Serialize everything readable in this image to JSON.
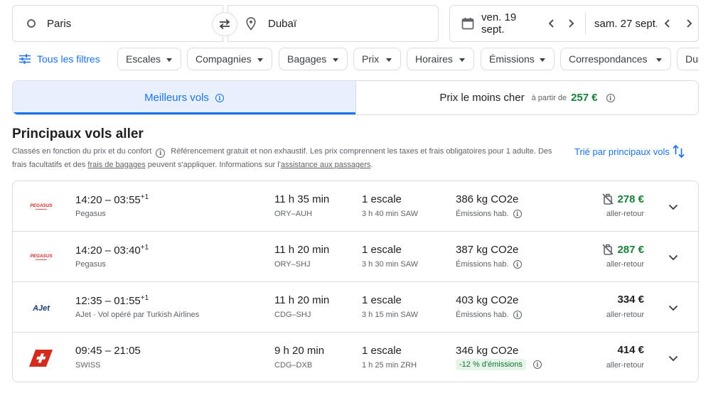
{
  "search": {
    "origin": "Paris",
    "destination": "Dubaï",
    "depart_date": "ven. 19 sept.",
    "return_date": "sam. 27 sept."
  },
  "filters": {
    "all_label": "Tous les filtres",
    "chips": [
      "Escales",
      "Compagnies",
      "Bagages",
      "Prix",
      "Horaires",
      "Émissions",
      "Correspondances",
      "Durée"
    ]
  },
  "tabs": {
    "best": "Meilleurs vols",
    "cheapest": "Prix le moins cher",
    "from_label": "à partir de",
    "from_price": "257 €"
  },
  "section": {
    "title": "Principaux vols aller",
    "desc_1": "Classés en fonction du prix et du confort",
    "desc_2": "Référencement gratuit et non exhaustif. Les prix comprennent les taxes et frais obligatoires pour 1 adulte. Des frais facultatifs et des",
    "desc_link_1": "frais de bagages",
    "desc_3": "peuvent s'appliquer. Informations sur l'",
    "desc_link_2": "assistance aux passagers",
    "desc_4": ".",
    "sort_label": "Trié par principaux vols"
  },
  "flights": [
    {
      "logo": "pegasus",
      "logo_text": "PEGASUS",
      "times": "14:20 – 03:55",
      "plus": "+1",
      "airline": "Pegasus",
      "duration": "11 h 35 min",
      "route": "ORY–AUH",
      "stops": "1 escale",
      "stop_detail": "3 h 40 min SAW",
      "co2": "386 kg CO2e",
      "emission_label": "Émissions hab.",
      "price": "278 €",
      "price_color": "#188038",
      "no_bag": true,
      "price_type": "aller-retour"
    },
    {
      "logo": "pegasus",
      "logo_text": "PEGASUS",
      "times": "14:20 – 03:40",
      "plus": "+1",
      "airline": "Pegasus",
      "duration": "11 h 20 min",
      "route": "ORY–SHJ",
      "stops": "1 escale",
      "stop_detail": "3 h 30 min SAW",
      "co2": "387 kg CO2e",
      "emission_label": "Émissions hab.",
      "price": "287 €",
      "price_color": "#188038",
      "no_bag": true,
      "price_type": "aller-retour"
    },
    {
      "logo": "ajet",
      "logo_text": "AJet",
      "times": "12:35 – 01:55",
      "plus": "+1",
      "airline": "AJet · Vol opéré par Turkish Airlines",
      "duration": "11 h 20 min",
      "route": "CDG–SHJ",
      "stops": "1 escale",
      "stop_detail": "3 h 15 min SAW",
      "co2": "403 kg CO2e",
      "emission_label": "Émissions hab.",
      "price": "334 €",
      "price_color": "#202124",
      "no_bag": false,
      "price_type": "aller-retour"
    },
    {
      "logo": "swiss",
      "logo_text": "",
      "times": "09:45 – 21:05",
      "plus": "",
      "airline": "SWISS",
      "duration": "9 h 20 min",
      "route": "CDG–DXB",
      "stops": "1 escale",
      "stop_detail": "1 h 25 min ZRH",
      "co2": "346 kg CO2e",
      "emission_label": "-12 % d'émissions",
      "emission_badge": true,
      "price": "414 €",
      "price_color": "#202124",
      "no_bag": false,
      "price_type": "aller-retour"
    }
  ],
  "colors": {
    "accent": "#1a73e8",
    "tab_active_bg": "#e8f0fe",
    "price_green": "#188038",
    "badge_bg": "#e6f4ea"
  },
  "icons": [
    "origin-ring-icon",
    "swap-icon",
    "location-pin-icon",
    "calendar-icon",
    "chevron-left-icon",
    "chevron-right-icon",
    "tune-icon",
    "dropdown-arrow-icon",
    "info-icon",
    "sort-icon",
    "no-bag-icon",
    "chevron-down-icon"
  ]
}
